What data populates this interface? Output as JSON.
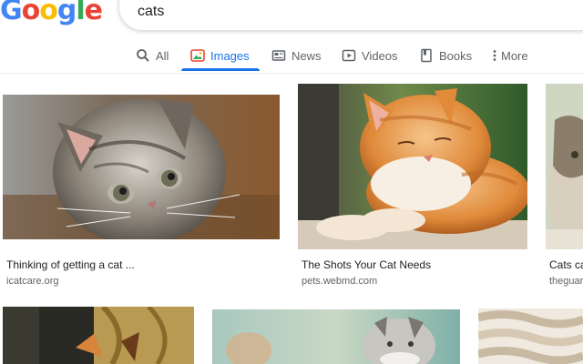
{
  "header": {
    "logo_letters": [
      {
        "ch": "G",
        "color": "#4285F4"
      },
      {
        "ch": "o",
        "color": "#EA4335"
      },
      {
        "ch": "o",
        "color": "#FBBC05"
      },
      {
        "ch": "g",
        "color": "#4285F4"
      },
      {
        "ch": "l",
        "color": "#34A853"
      },
      {
        "ch": "e",
        "color": "#EA4335"
      }
    ],
    "search_query": "cats"
  },
  "tabs": [
    {
      "label": "All",
      "icon": "search-icon"
    },
    {
      "label": "Images",
      "icon": "image-icon",
      "active": true
    },
    {
      "label": "News",
      "icon": "news-icon"
    },
    {
      "label": "Videos",
      "icon": "video-icon"
    },
    {
      "label": "Books",
      "icon": "book-icon"
    },
    {
      "label": "More",
      "icon": "more-vert-icon"
    }
  ],
  "results": [
    {
      "caption": "Thinking of getting a cat ...",
      "source": "icatcare.org"
    },
    {
      "caption": "The Shots Your Cat Needs",
      "source": "pets.webmd.com"
    },
    {
      "caption": "Cats ca",
      "source": "theguar"
    },
    {
      "caption": "",
      "source": ""
    },
    {
      "caption": "",
      "source": ""
    },
    {
      "caption": "",
      "source": ""
    }
  ],
  "colors": {
    "accent": "#1a73e8",
    "tab_text": "#5f6368",
    "source_text": "#5f6368"
  }
}
